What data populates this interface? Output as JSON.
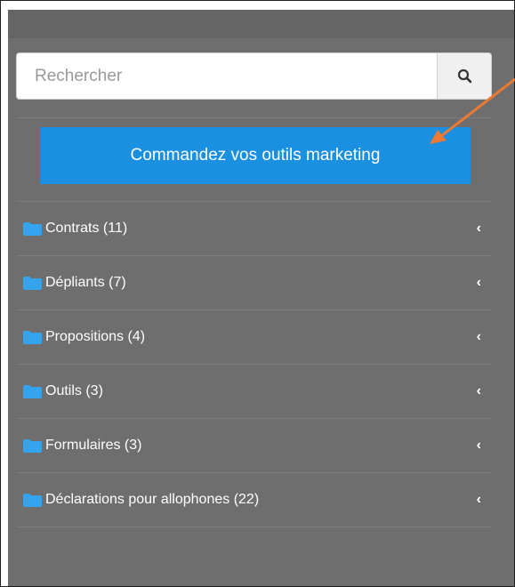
{
  "search": {
    "placeholder": "Rechercher",
    "button_icon": "search-icon"
  },
  "cta": {
    "label": "Commandez vos outils marketing",
    "color": "#1b8fe0"
  },
  "menu": {
    "items": [
      {
        "label": "Contrats (11)",
        "icon": "folder-icon",
        "chevron": "‹"
      },
      {
        "label": "Dépliants (7)",
        "icon": "folder-icon",
        "chevron": "‹"
      },
      {
        "label": "Propositions (4)",
        "icon": "folder-icon",
        "chevron": "‹"
      },
      {
        "label": "Outils (3)",
        "icon": "folder-icon",
        "chevron": "‹"
      },
      {
        "label": "Formulaires (3)",
        "icon": "folder-icon",
        "chevron": "‹"
      },
      {
        "label": "Déclarations pour allophones (22)",
        "icon": "folder-icon",
        "chevron": "‹"
      }
    ]
  },
  "colors": {
    "panel_bg": "#6e6e6e",
    "folder_icon": "#35a4ee",
    "annotation_arrow": "#ec7a34"
  }
}
